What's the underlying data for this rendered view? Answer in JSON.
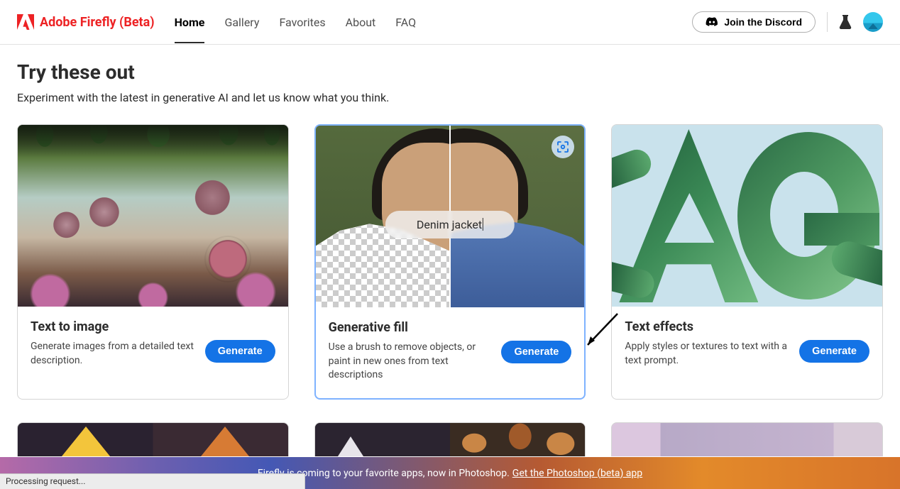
{
  "header": {
    "brand": "Adobe Firefly (Beta)",
    "nav": [
      "Home",
      "Gallery",
      "Favorites",
      "About",
      "FAQ"
    ],
    "active_nav_index": 0,
    "discord_label": "Join the Discord"
  },
  "page": {
    "title": "Try these out",
    "subtitle": "Experiment with the latest in generative AI and let us know what you think."
  },
  "cards": [
    {
      "title": "Text to image",
      "desc": "Generate images from a detailed text description.",
      "button": "Generate"
    },
    {
      "title": "Generative fill",
      "desc": "Use a brush to remove objects, or paint in new ones from text descriptions",
      "button": "Generate",
      "prompt_text": "Denim jacket"
    },
    {
      "title": "Text effects",
      "desc": "Apply styles or textures to text with a text prompt.",
      "button": "Generate"
    }
  ],
  "banner": {
    "text": "Firefly is coming to your favorite apps, now in Photoshop.",
    "link_text": "Get the Photoshop (beta) app"
  },
  "status": "Processing request...",
  "colors": {
    "brand_red": "#ed2224",
    "action_blue": "#1473e6"
  }
}
